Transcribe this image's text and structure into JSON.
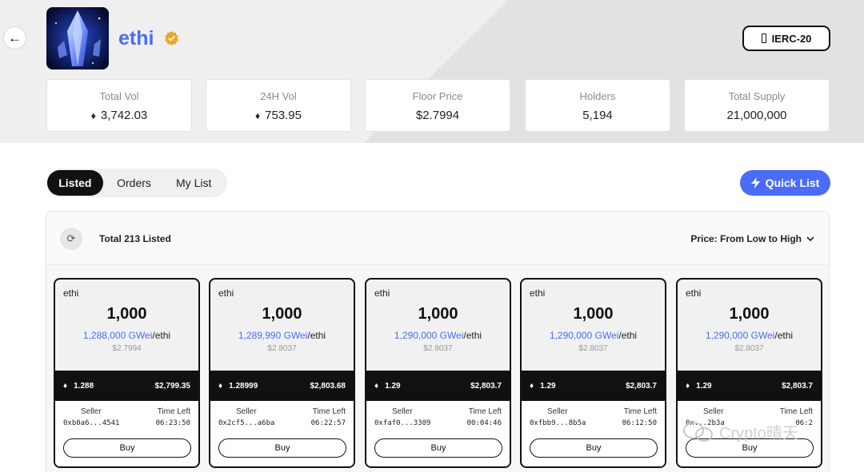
{
  "header": {
    "token_name": "ethi",
    "standard_badge": "IERC-20"
  },
  "stats": [
    {
      "label": "Total Vol",
      "value": "3,742.03"
    },
    {
      "label": "24H Vol",
      "value": "753.95"
    },
    {
      "label": "Floor Price",
      "value": "$2.7994"
    },
    {
      "label": "Holders",
      "value": "5,194"
    },
    {
      "label": "Total Supply",
      "value": "21,000,000"
    }
  ],
  "tabs": {
    "listed": "Listed",
    "orders": "Orders",
    "my_list": "My List"
  },
  "quick_list_label": "Quick List",
  "listing": {
    "total_label": "Total 213 Listed",
    "sort_label": "Price: From Low to High"
  },
  "cards": [
    {
      "tick": "ethi",
      "amount": "1,000",
      "gwei": "1,288,000 GWei",
      "per": "/ethi",
      "usd_unit": "$2.7994",
      "eth_total": "1.288",
      "usd_total": "$2,799.35",
      "seller_label": "Seller",
      "time_label": "Time Left",
      "seller": "0xb0a6...4541",
      "time_left": "06:23:50",
      "buy": "Buy"
    },
    {
      "tick": "ethi",
      "amount": "1,000",
      "gwei": "1,289,990 GWei",
      "per": "/ethi",
      "usd_unit": "$2.8037",
      "eth_total": "1.28999",
      "usd_total": "$2,803.68",
      "seller_label": "Seller",
      "time_label": "Time Left",
      "seller": "0x2cf5...a6ba",
      "time_left": "06:22:57",
      "buy": "Buy"
    },
    {
      "tick": "ethi",
      "amount": "1,000",
      "gwei": "1,290,000 GWei",
      "per": "/ethi",
      "usd_unit": "$2.8037",
      "eth_total": "1.29",
      "usd_total": "$2,803.7",
      "seller_label": "Seller",
      "time_label": "Time Left",
      "seller": "0xfaf0...3309",
      "time_left": "00:04:46",
      "buy": "Buy"
    },
    {
      "tick": "ethi",
      "amount": "1,000",
      "gwei": "1,290,000 GWei",
      "per": "/ethi",
      "usd_unit": "$2.8037",
      "eth_total": "1.29",
      "usd_total": "$2,803.7",
      "seller_label": "Seller",
      "time_label": "Time Left",
      "seller": "0xfbb9...8b5a",
      "time_left": "06:12:50",
      "buy": "Buy"
    },
    {
      "tick": "ethi",
      "amount": "1,000",
      "gwei": "1,290,000 GWei",
      "per": "/ethi",
      "usd_unit": "$2.8037",
      "eth_total": "1.29",
      "usd_total": "$2,803.7",
      "seller_label": "Seller",
      "time_label": "Time Left",
      "seller": "0x...2b3a",
      "time_left": "06:2",
      "buy": "Buy"
    }
  ],
  "watermark": "Crypto晴天",
  "colors": {
    "accent": "#4a6cf7",
    "verified": "#e8a92a",
    "dark": "#111111"
  },
  "icons": {
    "back": "arrow-left-icon",
    "verified": "verified-badge-icon",
    "eth": "ethereum-icon",
    "refresh": "refresh-icon",
    "chevron": "chevron-down-icon",
    "bolt": "lightning-icon"
  }
}
